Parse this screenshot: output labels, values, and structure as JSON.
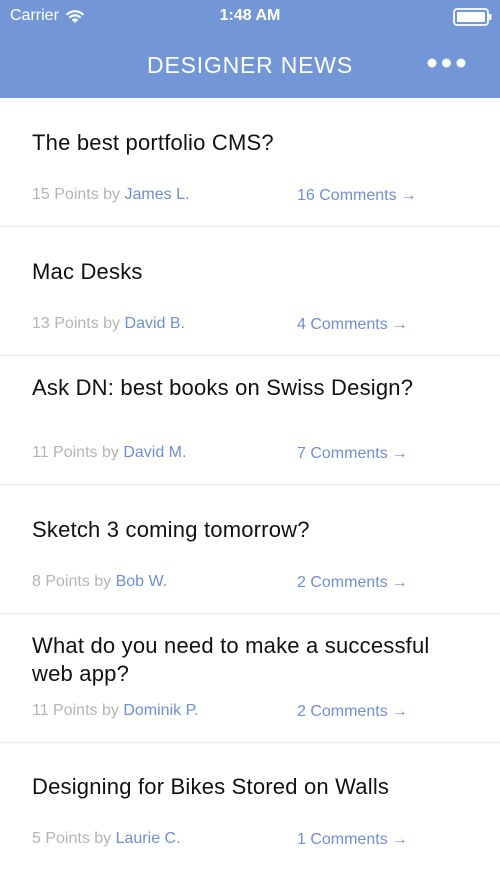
{
  "status_bar": {
    "carrier": "Carrier",
    "time": "1:48 AM"
  },
  "navigation": {
    "title": "DESIGNER NEWS",
    "more_icon": "more-horizontal-icon"
  },
  "colors": {
    "header_background": "#7397d6",
    "link_blue": "#6f8fd4",
    "muted_text": "#b4b4b4",
    "divider": "#e7e7e7"
  },
  "feed": {
    "items": [
      {
        "title": "The best portfolio CMS?",
        "points": "15 Points by",
        "author": "James L.",
        "comments": "16 Comments",
        "arrow": "→"
      },
      {
        "title": "Mac Desks",
        "points": "13 Points by",
        "author": "David B.",
        "comments": "4 Comments",
        "arrow": "→"
      },
      {
        "title": "Ask DN: best books on Swiss Design?",
        "points": "11 Points by",
        "author": "David M.",
        "comments": "7 Comments",
        "arrow": "→"
      },
      {
        "title": "Sketch 3 coming tomorrow?",
        "points": "8 Points by",
        "author": "Bob W.",
        "comments": "2 Comments",
        "arrow": "→"
      },
      {
        "title": "What do you need to make a successful web app?",
        "points": "11 Points by",
        "author": "Dominik P.",
        "comments": "2 Comments",
        "arrow": "→"
      },
      {
        "title": "Designing for Bikes Stored on Walls",
        "points": "5 Points by",
        "author": "Laurie C.",
        "comments": "1 Comments",
        "arrow": "→"
      }
    ]
  }
}
